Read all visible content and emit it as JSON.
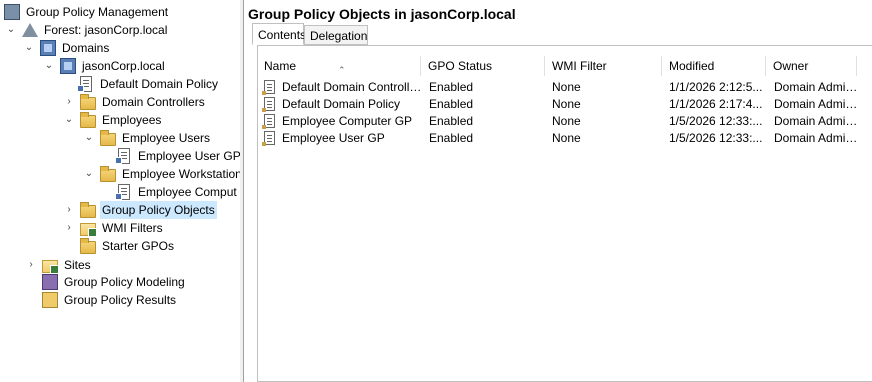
{
  "tree": {
    "root": "Group Policy Management",
    "forest": "Forest: jasonCorp.local",
    "domains": "Domains",
    "domain": "jasonCorp.local",
    "default_domain_policy": "Default Domain Policy",
    "domain_controllers": "Domain Controllers",
    "employees": "Employees",
    "employee_users": "Employee Users",
    "employee_user_gp": "Employee User GP",
    "employee_workstations": "Employee Workstation",
    "employee_computer_gp": "Employee Comput",
    "group_policy_objects": "Group Policy Objects",
    "wmi_filters": "WMI Filters",
    "starter_gpos": "Starter GPOs",
    "sites": "Sites",
    "modeling": "Group Policy Modeling",
    "results": "Group Policy Results"
  },
  "details": {
    "title": "Group Policy Objects in jasonCorp.local",
    "tabs": [
      "Contents",
      "Delegation"
    ],
    "columns": [
      "Name",
      "GPO Status",
      "WMI Filter",
      "Modified",
      "Owner"
    ],
    "rows": [
      [
        "Default Domain Controllers ...",
        "Enabled",
        "None",
        "1/1/2026 2:12:5...",
        "Domain Admin..."
      ],
      [
        "Default Domain Policy",
        "Enabled",
        "None",
        "1/1/2026 2:17:4...",
        "Domain Admin..."
      ],
      [
        "Employee Computer GP",
        "Enabled",
        "None",
        "1/5/2026 12:33:...",
        "Domain Admin..."
      ],
      [
        "Employee User GP",
        "Enabled",
        "None",
        "1/5/2026 12:33:...",
        "Domain Admin..."
      ]
    ]
  }
}
